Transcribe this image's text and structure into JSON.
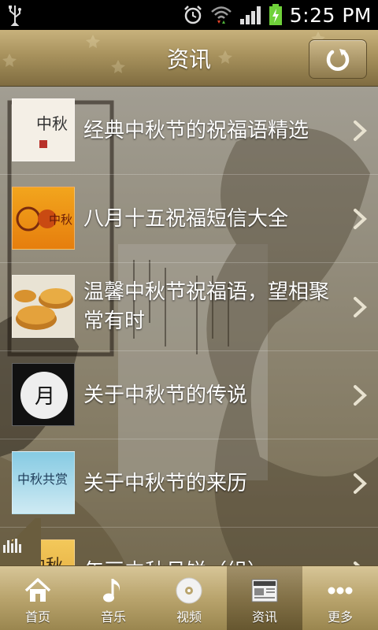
{
  "status_bar": {
    "time": "5:25 PM",
    "icons": [
      "usb-icon",
      "alarm-icon",
      "wifi-icon",
      "signal-icon",
      "battery-charging-icon"
    ]
  },
  "header": {
    "title": "资讯",
    "refresh_icon": "refresh-icon"
  },
  "items": [
    {
      "title": "经典中秋节的祝福语精选",
      "thumb": "中秋"
    },
    {
      "title": "八月十五祝福短信大全",
      "thumb": "中秋"
    },
    {
      "title": "温馨中秋节祝福语，望相聚常有时",
      "thumb": "mooncakes"
    },
    {
      "title": "关于中秋节的传说",
      "thumb": "月"
    },
    {
      "title": "关于中秋节的来历",
      "thumb": "中秋共赏"
    },
    {
      "title": "年画中秋月饼（组）",
      "thumb": "中秋"
    }
  ],
  "tabs": [
    {
      "label": "首页",
      "icon": "home-icon",
      "active": false
    },
    {
      "label": "音乐",
      "icon": "music-note-icon",
      "active": false
    },
    {
      "label": "视频",
      "icon": "disc-icon",
      "active": false
    },
    {
      "label": "资讯",
      "icon": "news-icon",
      "active": true
    },
    {
      "label": "更多",
      "icon": "more-dots-icon",
      "active": false
    }
  ]
}
